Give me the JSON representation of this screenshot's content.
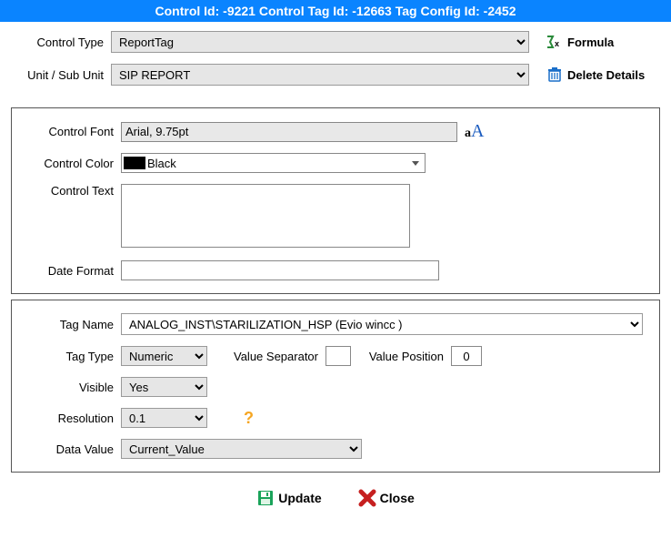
{
  "header": {
    "title": "Control Id: -9221 Control Tag Id: -12663 Tag Config Id: -2452"
  },
  "top": {
    "controlTypeLabel": "Control Type",
    "controlTypeValue": "ReportTag",
    "formulaLabel": "Formula",
    "unitLabel": "Unit / Sub Unit",
    "unitValue": "SIP REPORT",
    "deleteLabel": "Delete Details"
  },
  "panel1": {
    "controlFontLabel": "Control Font",
    "controlFontValue": "Arial, 9.75pt",
    "controlColorLabel": "Control Color",
    "controlColorValue": "Black",
    "controlTextLabel": "Control Text",
    "controlTextValue": "",
    "dateFormatLabel": "Date Format",
    "dateFormatValue": ""
  },
  "panel2": {
    "tagNameLabel": "Tag Name",
    "tagNameValue": "ANALOG_INST\\STARILIZATION_HSP (Evio wincc )",
    "tagTypeLabel": "Tag Type",
    "tagTypeValue": "Numeric",
    "valueSeparatorLabel": "Value Separator",
    "valueSeparatorValue": "",
    "valuePositionLabel": "Value Position",
    "valuePositionValue": "0",
    "visibleLabel": "Visible",
    "visibleValue": "Yes",
    "resolutionLabel": "Resolution",
    "resolutionValue": "0.1",
    "dataValueLabel": "Data Value",
    "dataValueValue": "Current_Value",
    "helpTooltip": "?"
  },
  "buttons": {
    "update": "Update",
    "close": "Close"
  }
}
